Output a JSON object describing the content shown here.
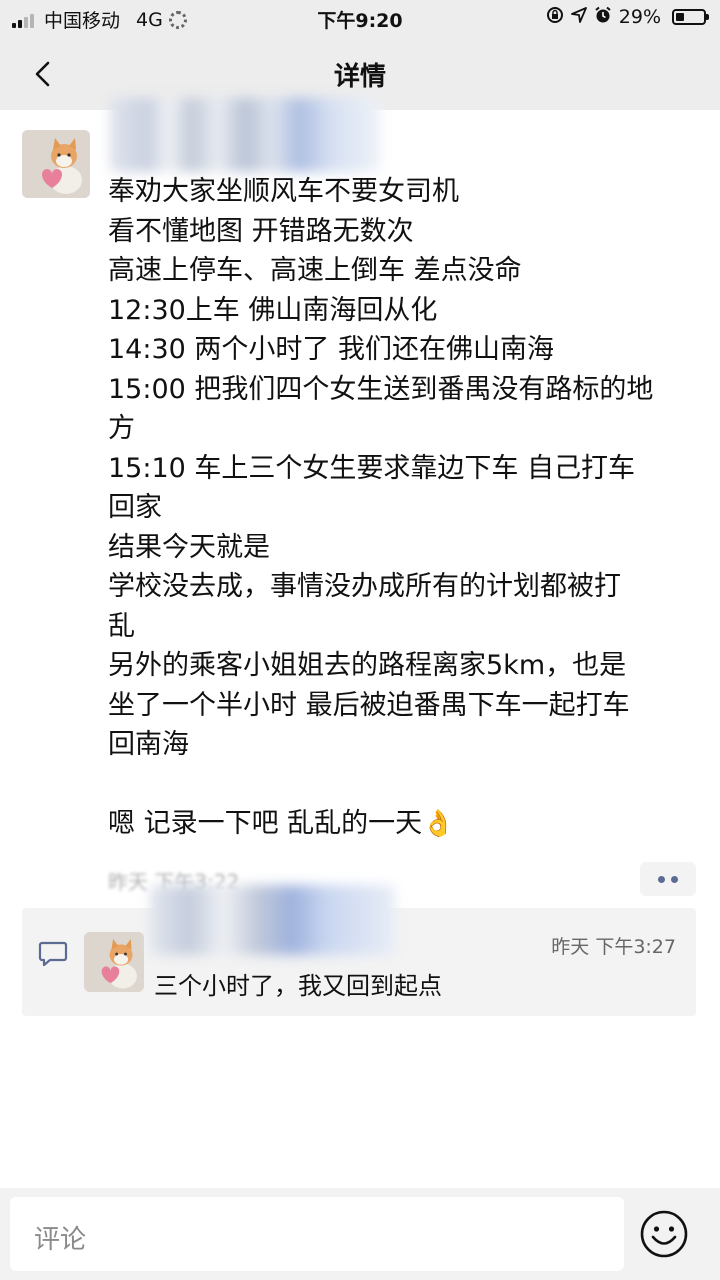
{
  "status_bar": {
    "carrier": "中国移动",
    "network": "4G",
    "time": "下午9:20",
    "battery_text": "29%",
    "battery_level": 0.29
  },
  "nav": {
    "title": "详情",
    "back_icon": "chevron-left-icon"
  },
  "post": {
    "lines": [
      "奉劝大家坐顺风车不要女司机",
      "看不懂地图 开错路无数次",
      "高速上停车、高速上倒车 差点没命",
      "12:30上车 佛山南海回从化",
      "14:30 两个小时了 我们还在佛山南海",
      "15:00 把我们四个女生送到番禺没有路标的地",
      "方",
      "15:10 车上三个女生要求靠边下车 自己打车",
      "回家",
      "结果今天就是",
      "学校没去成，事情没办成所有的计划都被打",
      "乱",
      "另外的乘客小姐姐去的路程离家5km，也是",
      "坐了一个半小时 最后被迫番禺下车一起打车",
      "回南海",
      "",
      "嗯 记录一下吧 乱乱的一天"
    ],
    "emoji": "ok-hand-emoji",
    "timestamp": "昨天 下午3:22",
    "more_icon": "more-dots-icon"
  },
  "comment": {
    "time": "昨天 下午3:27",
    "text": "三个小时了，我又回到起点",
    "icon": "comment-bubble-icon"
  },
  "input": {
    "placeholder": "评论",
    "emoji_icon": "smiley-icon"
  },
  "colors": {
    "bar_bg": "#ededed",
    "comment_bg": "#f3f3f3",
    "link_blue": "#5b6b91",
    "text": "#111111"
  }
}
